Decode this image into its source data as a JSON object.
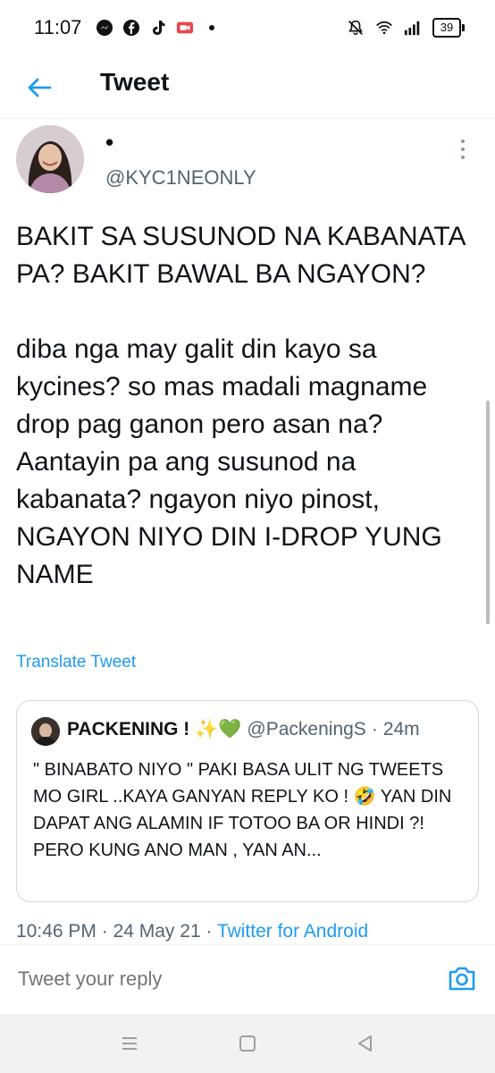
{
  "status_bar": {
    "time": "11:07",
    "left_icons": [
      "messenger-icon",
      "facebook-icon",
      "tiktok-icon",
      "screen-record-icon",
      "dot-icon"
    ],
    "right_icons": [
      "mute-icon",
      "wifi-icon",
      "signal-icon"
    ],
    "battery": "39"
  },
  "header": {
    "title": "Tweet",
    "back_icon": "arrow-left-icon"
  },
  "tweet": {
    "display_name": "•",
    "handle": "@KYC1NEONLY",
    "paragraph1": "BAKIT SA SUSUNOD NA KABANATA PA? BAKIT BAWAL BA NGAYON?",
    "paragraph2": "diba nga may galit din kayo sa kycines? so mas madali magname drop pag ganon pero asan na? Aantayin pa ang susunod na kabanata? ngayon niyo pinost, NGAYON NIYO DIN I-DROP YUNG NAME",
    "translate": "Translate Tweet",
    "time": "10:46 PM",
    "date": "24 May 21",
    "source": "Twitter for Android"
  },
  "quote": {
    "name": "PACKENING ! ✨💚",
    "handle": "@PackeningS",
    "age": "24m",
    "text": "\" BINABATO NIYO \" PAKI BASA ULIT NG TWEETS MO GIRL ..KAYA GANYAN REPLY KO ! 🤣 YAN DIN DAPAT ANG ALAMIN IF TOTOO BA OR HINDI ?! PERO KUNG ANO MAN , YAN AN..."
  },
  "reply": {
    "placeholder": "Tweet your reply"
  },
  "colors": {
    "accent": "#1d9bf0",
    "secondary_text": "#536471",
    "border": "#cfd9de"
  }
}
